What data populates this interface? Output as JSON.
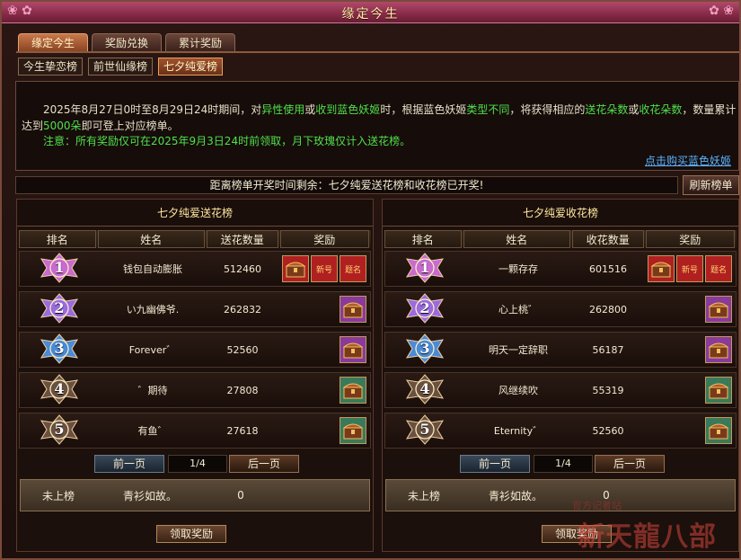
{
  "window": {
    "title": "缘定今生"
  },
  "tabs": [
    {
      "label": "缘定今生",
      "active": true
    },
    {
      "label": "奖励兑换",
      "active": false
    },
    {
      "label": "累计奖励",
      "active": false
    }
  ],
  "subtabs": [
    {
      "label": "今生挚恋榜",
      "active": false
    },
    {
      "label": "前世仙缘榜",
      "active": false
    },
    {
      "label": "七夕纯爱榜",
      "active": true
    }
  ],
  "info": {
    "p1": {
      "a": "2025年8月27日0时至8月29日24时期间，对",
      "b": "异性使用",
      "c": "或",
      "d": "收到蓝色妖姬",
      "e": "时，根据蓝色妖姬",
      "f": "类型不同",
      "g": "，将获得相应的",
      "h": "送花朵数",
      "i": "或",
      "j": "收花朵数",
      "k": "，数量累计达到",
      "l": "5000朵",
      "m": "即可登上对应榜单。"
    },
    "note": "注意：所有奖励仅可在2025年9月3日24时前领取，月下玫瑰仅计入送花榜。",
    "buy_link": "点击购买蓝色妖姬"
  },
  "countdown": "距离榜单开奖时间剩余：七夕纯爱送花榜和收花榜已开奖!",
  "refresh_label": "刷新榜单",
  "colors": {
    "rank1": "#c86ad0",
    "rank2": "#9a6ae0",
    "rank3": "#4a8ad8",
    "rank_other": "#6a5040",
    "reward_red": "#b02020",
    "reward_purple": "#8a3a9a",
    "reward_green": "#3a7a5a"
  },
  "send_board": {
    "title": "七夕纯爱送花榜",
    "headers": [
      "排名",
      "姓名",
      "送花数量",
      "奖励"
    ],
    "rows": [
      {
        "rank": "1",
        "name": "钱包自动膨胀",
        "value": "512460",
        "rewards": [
          "chest-icon",
          "新号",
          "题名"
        ]
      },
      {
        "rank": "2",
        "name": "い九幽佛爷.",
        "value": "262832",
        "rewards": [
          "chest-icon"
        ]
      },
      {
        "rank": "3",
        "name": "Forever゛",
        "value": "52560",
        "rewards": [
          "chest-icon"
        ]
      },
      {
        "rank": "4",
        "name": "゛期待",
        "value": "27808",
        "rewards": [
          "chest-icon"
        ]
      },
      {
        "rank": "5",
        "name": "有鱼゛",
        "value": "27618",
        "rewards": [
          "chest-icon"
        ]
      }
    ],
    "pager": {
      "prev": "前一页",
      "page": "1/4",
      "next": "后一页"
    },
    "mine": {
      "status": "未上榜",
      "name": "青衫如故。",
      "value": "0"
    },
    "claim": "领取奖励"
  },
  "recv_board": {
    "title": "七夕纯爱收花榜",
    "headers": [
      "排名",
      "姓名",
      "收花数量",
      "奖励"
    ],
    "rows": [
      {
        "rank": "1",
        "name": "一颗存存",
        "value": "601516",
        "rewards": [
          "chest-icon",
          "新号",
          "题名"
        ]
      },
      {
        "rank": "2",
        "name": "心上桃゛",
        "value": "262800",
        "rewards": [
          "chest-icon"
        ]
      },
      {
        "rank": "3",
        "name": "明天一定辞职",
        "value": "56187",
        "rewards": [
          "chest-icon"
        ]
      },
      {
        "rank": "4",
        "name": "风继续吹",
        "value": "55319",
        "rewards": [
          "chest-icon"
        ]
      },
      {
        "rank": "5",
        "name": "Eternity゛",
        "value": "52560",
        "rewards": [
          "chest-icon"
        ]
      }
    ],
    "pager": {
      "prev": "前一页",
      "page": "1/4",
      "next": "后一页"
    },
    "mine": {
      "status": "未上榜",
      "name": "青衫如故。",
      "value": "0"
    },
    "claim": "领取奖励"
  },
  "watermark": {
    "top": "官方记者站",
    "main": "新天龍八部"
  }
}
